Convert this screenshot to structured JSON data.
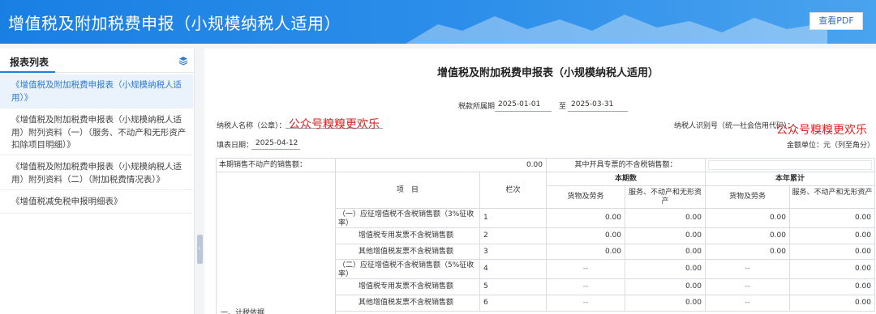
{
  "header": {
    "title": "增值税及附加税费申报（小规模纳税人适用）",
    "pdf_button": "查看PDF"
  },
  "sidebar": {
    "title": "报表列表",
    "items": [
      {
        "label": "《增值税及附加税费申报表（小规模纳税人适用）》",
        "active": true
      },
      {
        "label": "《增值税及附加税费申报表（小规模纳税人适用）附列资料（一）（服务、不动产和无形资产扣除项目明细）》",
        "active": false
      },
      {
        "label": "《增值税及附加税费申报表（小规模纳税人适用）附列资料（二）（附加税费情况表）》",
        "active": false
      },
      {
        "label": "《增值税减免税申报明细表》",
        "active": false
      }
    ]
  },
  "doc": {
    "title": "增值税及附加税费申报表（小规模纳税人适用）",
    "period_label": "税款所属期",
    "period_start": "2025-01-01",
    "period_to": "至",
    "period_end": "2025-03-31",
    "taxpayer_name_label": "纳税人名称（公章）：",
    "taxpayer_id_label": "纳税人识别号（统一社会信用代码）：",
    "fill_date_label": "填表日期：",
    "fill_date": "2025-04-12",
    "unit_label": "金额单位：元（列至角分）",
    "watermark": "公众号糗糗更欢乐"
  },
  "table": {
    "top_row": {
      "label1": "本期销售不动产的销售额：",
      "value1": "0.00",
      "label2": "其中开具专票的不含税销售额：",
      "value2": ""
    },
    "headers": {
      "item": "项　目",
      "col": "栏次",
      "current": "本期数",
      "ytd": "本年累计",
      "goods": "货物及劳务",
      "services": "服务、不动产和无形资产"
    },
    "section_label": "一、计税依据",
    "rows": [
      {
        "item": "（一）应征增值税不含税销售额（3%征收率）",
        "col": "1",
        "v": [
          "0.00",
          "0.00",
          "0.00",
          "0.00"
        ]
      },
      {
        "item": "增值税专用发票不含税销售额",
        "col": "2",
        "v": [
          "0.00",
          "0.00",
          "0.00",
          "0.00"
        ]
      },
      {
        "item": "其他增值税发票不含税销售额",
        "col": "3",
        "v": [
          "0.00",
          "0.00",
          "0.00",
          "0.00"
        ]
      },
      {
        "item": "（二）应征增值税不含税销售额（5%征收率）",
        "col": "4",
        "v": [
          "--",
          "0.00",
          "--",
          "0.00"
        ]
      },
      {
        "item": "增值税专用发票不含税销售额",
        "col": "5",
        "v": [
          "--",
          "0.00",
          "--",
          "0.00"
        ]
      },
      {
        "item": "其他增值税发票不含税销售额",
        "col": "6",
        "v": [
          "--",
          "0.00",
          "--",
          "0.00"
        ]
      }
    ]
  }
}
